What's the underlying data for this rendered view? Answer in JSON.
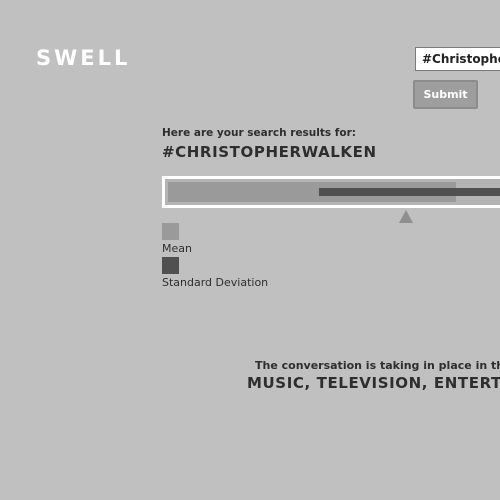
{
  "header": {
    "logo_text": "SWELL",
    "search": {
      "value": "#ChristopherW"
    },
    "submit_label": "Submit"
  },
  "results": {
    "intro": "Here are your search results for:",
    "query": "#CHRISTOPHERWALKEN"
  },
  "chart_data": {
    "type": "bar",
    "series": [
      {
        "name": "Mean"
      },
      {
        "name": "Standard Deviation"
      }
    ]
  },
  "legend": {
    "mean_label": "Mean",
    "sd_label": "Standard Deviation"
  },
  "colors": {
    "background": "#c0c0c0",
    "mean": "#9a9a9a",
    "standard_deviation": "#505050",
    "marker": "#8f8f8f"
  },
  "conversation": {
    "intro": "The conversation is taking in place in these c",
    "categories": "MUSIC, TELEVISION, ENTERTA"
  }
}
